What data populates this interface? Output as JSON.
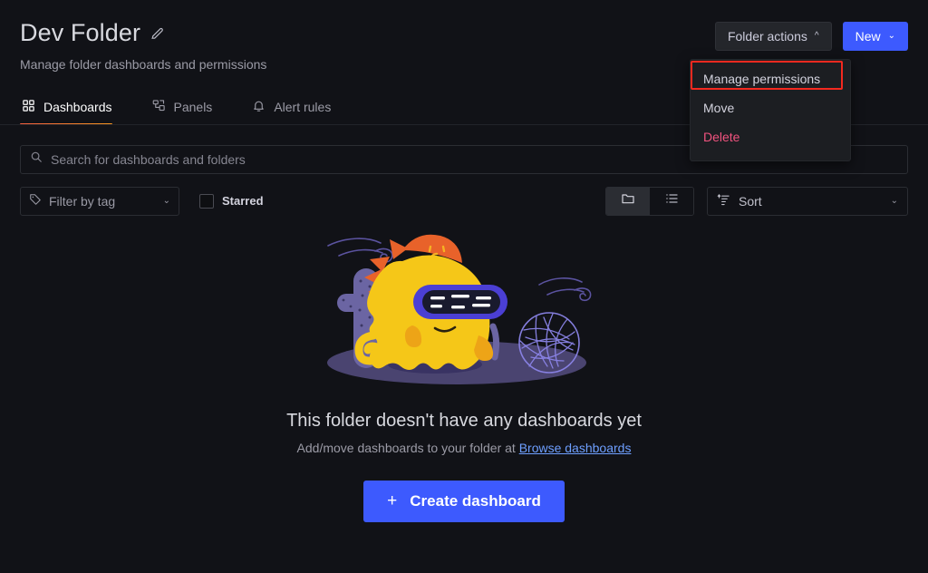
{
  "header": {
    "title": "Dev Folder",
    "edit_icon": "pencil-icon",
    "subtitle": "Manage folder dashboards and permissions",
    "folder_actions_label": "Folder actions",
    "folder_actions_chevron": "chevron-up-icon",
    "new_label": "New",
    "new_chevron": "chevron-down-icon"
  },
  "menu": {
    "items": [
      {
        "label": "Manage permissions",
        "highlighted": true
      },
      {
        "label": "Move",
        "highlighted": false
      },
      {
        "label": "Delete",
        "highlighted": false
      }
    ]
  },
  "tabs": [
    {
      "label": "Dashboards",
      "icon": "apps-grid-icon",
      "active": true
    },
    {
      "label": "Panels",
      "icon": "library-panel-icon",
      "active": false
    },
    {
      "label": "Alert rules",
      "icon": "bell-icon",
      "active": false
    }
  ],
  "search": {
    "placeholder": "Search for dashboards and folders",
    "value": "",
    "icon": "search-icon"
  },
  "filters": {
    "tag_label": "Filter by tag",
    "tag_icon": "tag-icon",
    "starred_label": "Starred",
    "starred_checked": false,
    "view_folder_icon": "folder-icon",
    "view_list_icon": "list-icon",
    "view_selected": "folder",
    "sort_label": "Sort",
    "sort_icon": "sort-amount-up-icon"
  },
  "empty_state": {
    "illustration": "grafana-mascot-desert-illustration",
    "title": "This folder doesn't have any dashboards yet",
    "subtitle_prefix": "Add/move dashboards to your folder at ",
    "link_label": "Browse dashboards",
    "create_button_label": "Create dashboard",
    "create_button_icon": "plus-icon"
  },
  "colors": {
    "background": "#111217",
    "accent_blue": "#3d5afe",
    "accent_orange": "#f55f3e",
    "danger": "#f1537f",
    "highlight_outline": "#f4291f",
    "link": "#6e9fff"
  }
}
